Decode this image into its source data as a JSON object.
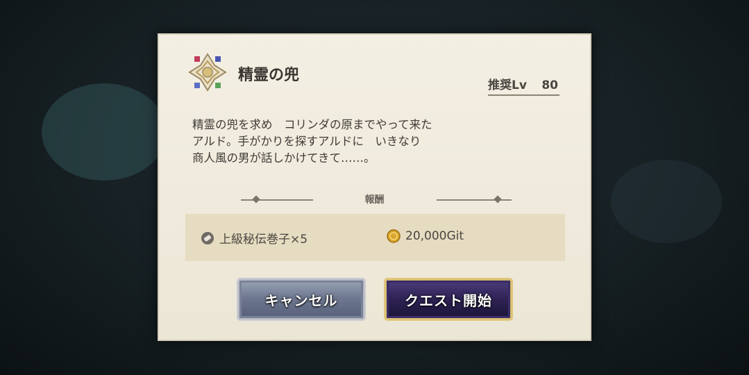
{
  "quest": {
    "title": "精霊の兜",
    "recommended_label": "推奨Lv",
    "recommended_level": "80",
    "description": [
      "精霊の兜を求め　コリンダの原までやって来た",
      "アルド。手がかりを探すアルドに　いきなり",
      "商人風の男が話しかけてきて……。"
    ]
  },
  "rewards": {
    "title": "報酬",
    "items": [
      {
        "icon": "scroll-icon",
        "label": "上級秘伝巻子×5"
      },
      {
        "icon": "coin-icon",
        "label": "20,000Git"
      }
    ]
  },
  "buttons": {
    "cancel": "キャンセル",
    "start": "クエスト開始"
  }
}
